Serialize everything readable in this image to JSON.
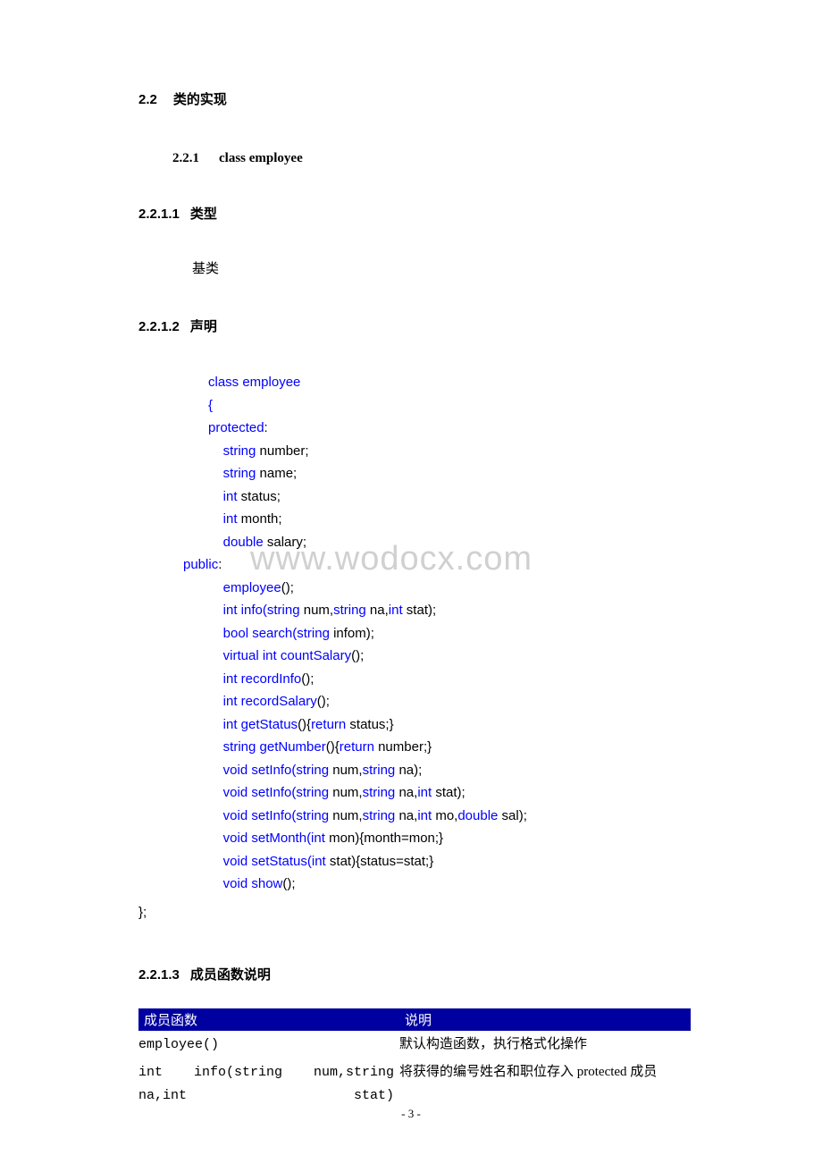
{
  "section": {
    "h2_num": "2.2",
    "h2_title": "类的实现",
    "h3_num": "2.2.1",
    "h3_title": "class employee",
    "h4a_num": "2.2.1.1",
    "h4a_title": "类型",
    "type_text": "基类",
    "h4b_num": "2.2.1.2",
    "h4b_title": "声明",
    "h4c_num": "2.2.1.3",
    "h4c_title": "成员函数说明"
  },
  "code": {
    "l0": "class employee",
    "l1": "{",
    "l2": "protected",
    "l2b": ":",
    "l3a": "    string",
    "l3b": " number;",
    "l4a": "    string",
    "l4b": " name;",
    "l5a": "    int",
    "l5b": " status;",
    "l6a": "    int",
    "l6b": " month;",
    "l7a": "    double",
    "l7b": " salary;",
    "l8": "public",
    "l8b": ":",
    "l9a": "    employee",
    "l9b": "();",
    "l10a": "    int",
    "l10b": " info",
    "l10c": "(string",
    "l10d": " num,",
    "l10e": "string",
    "l10f": " na,",
    "l10g": "int",
    "l10h": " stat);",
    "l11a": "    bool",
    "l11b": " search",
    "l11c": "(string",
    "l11d": " infom);",
    "l12a": "    virtual int",
    "l12b": " countSalary",
    "l12c": "();",
    "l13a": "    int",
    "l13b": " recordInfo",
    "l13c": "();",
    "l14a": "    int",
    "l14b": " recordSalary",
    "l14c": "();",
    "l15a": "    int",
    "l15b": " getStatus",
    "l15c": "(){",
    "l15d": "return",
    "l15e": " status;}",
    "l16a": "    string",
    "l16b": " getNumber",
    "l16c": "(){",
    "l16d": "return",
    "l16e": " number;}",
    "l17a": "    void",
    "l17b": " setInfo",
    "l17c": "(string",
    "l17d": " num,",
    "l17e": "string",
    "l17f": " na);",
    "l18a": "    void",
    "l18b": " setInfo",
    "l18c": "(string",
    "l18d": " num,",
    "l18e": "string",
    "l18f": " na,",
    "l18g": "int",
    "l18h": " stat);",
    "l19a": "    void",
    "l19b": " setInfo",
    "l19c": "(string",
    "l19d": " num,",
    "l19e": "string",
    "l19f": " na,",
    "l19g": "int",
    "l19h": " mo,",
    "l19i": "double",
    "l19j": " sal);",
    "l20a": "    void",
    "l20b": " setMonth",
    "l20c": "(int",
    "l20d": " mon){month=mon;}",
    "l21a": "    void",
    "l21b": " setStatus",
    "l21c": "(int",
    "l21d": " stat){status=stat;}",
    "l22a": "    void",
    "l22b": " show",
    "l22c": "();",
    "close": "};"
  },
  "table": {
    "th1": "成员函数",
    "th2": "说明",
    "r1c1": "employee()",
    "r1c2": "默认构造函数，执行格式化操作",
    "r2c1": "int  info(string  num,string  na,int stat)",
    "r2c2": "将获得的编号姓名和职位存入 protected 成员"
  },
  "watermark": "www.wodocx.com",
  "page_number": "- 3 -"
}
